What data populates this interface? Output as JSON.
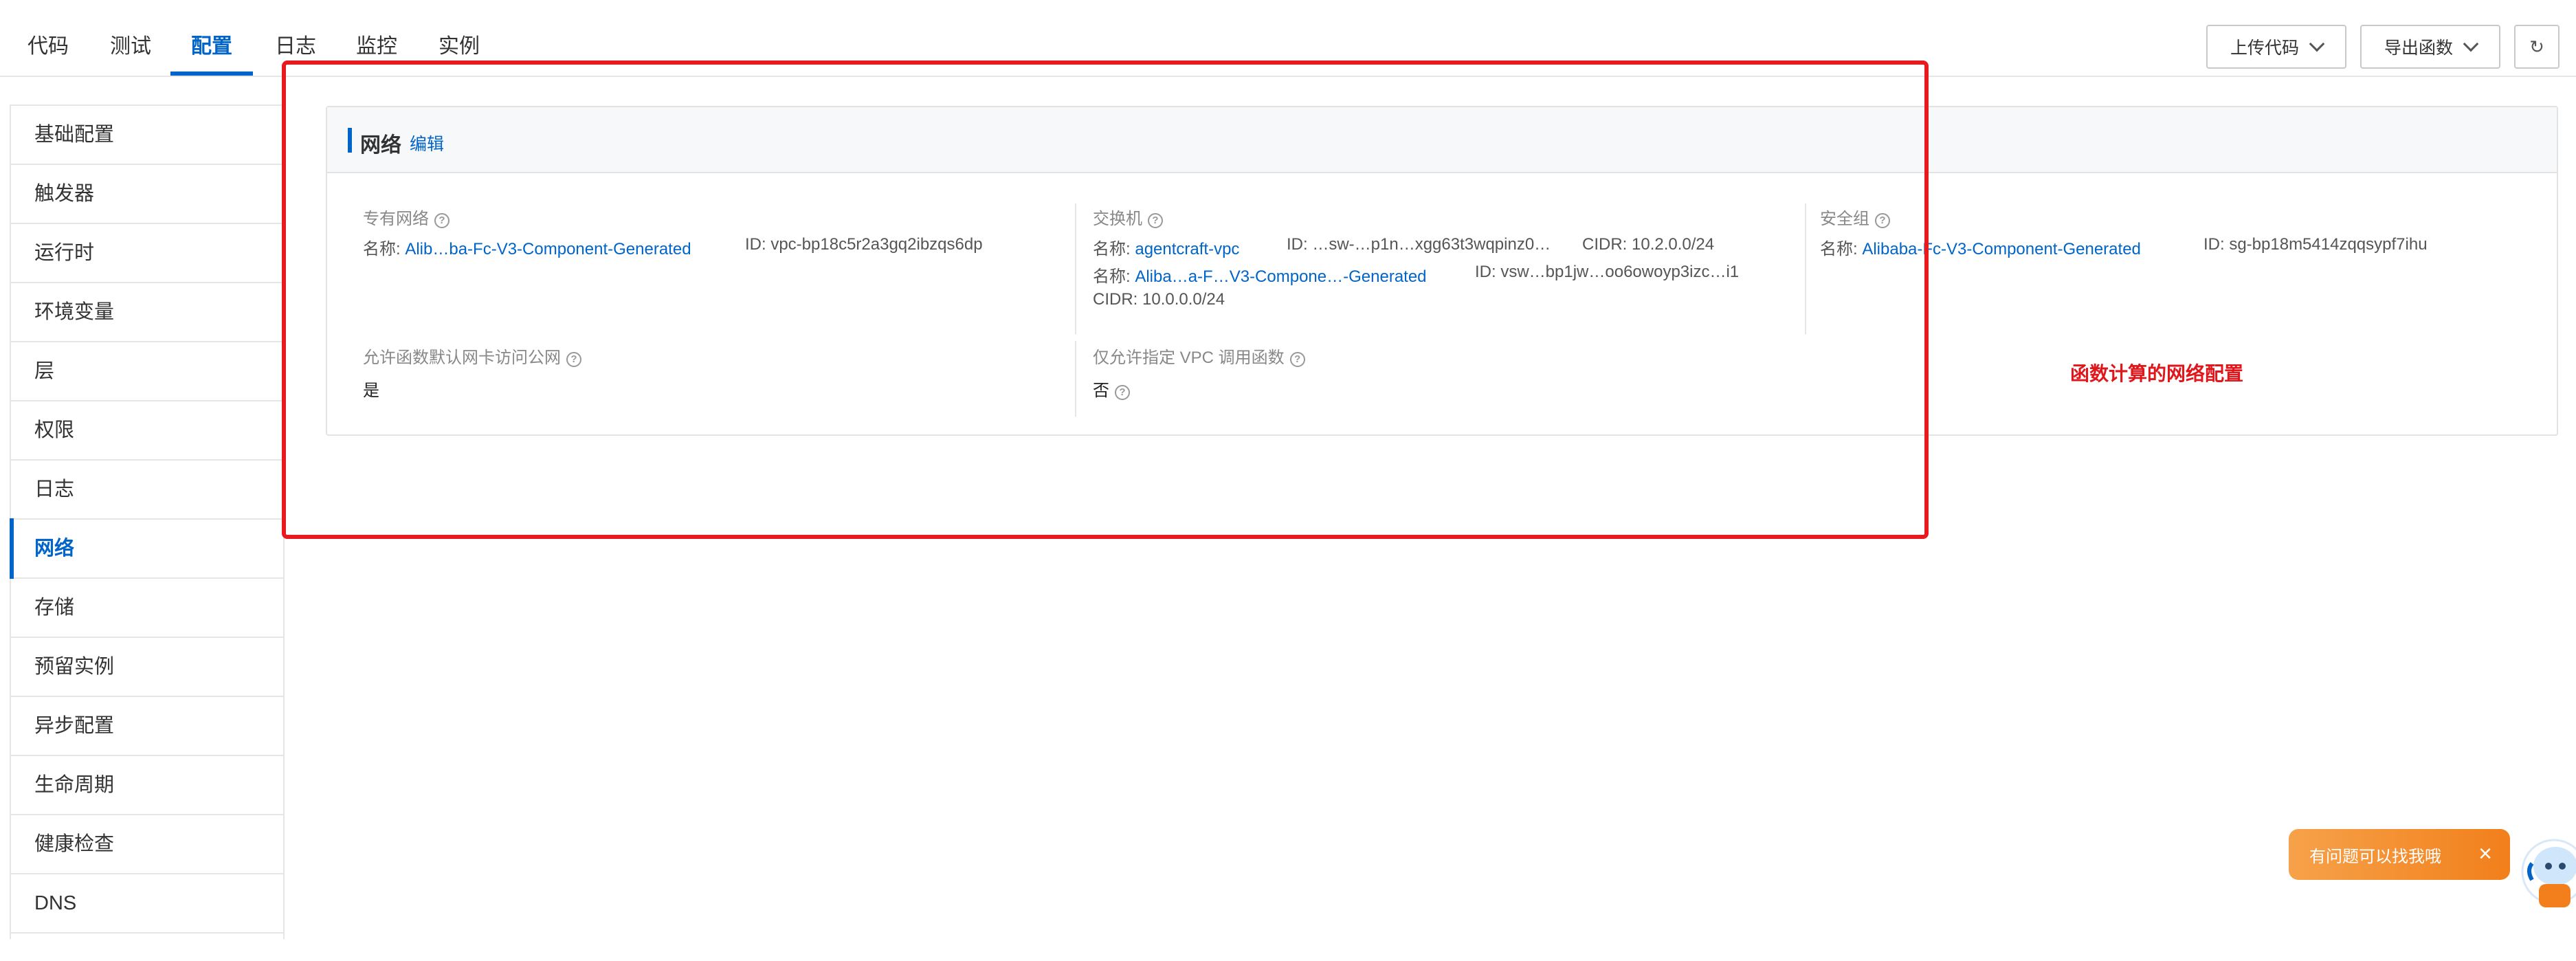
{
  "tabs": [
    {
      "label": "代码",
      "active": false
    },
    {
      "label": "测试",
      "active": false
    },
    {
      "label": "配置",
      "active": true
    },
    {
      "label": "日志",
      "active": false
    },
    {
      "label": "监控",
      "active": false
    },
    {
      "label": "实例",
      "active": false
    }
  ],
  "toolbar": {
    "upload_label": "上传代码",
    "export_label": "导出函数",
    "refresh_icon": "refresh-icon"
  },
  "sidebar": {
    "items": [
      {
        "label": "基础配置"
      },
      {
        "label": "触发器"
      },
      {
        "label": "运行时"
      },
      {
        "label": "环境变量"
      },
      {
        "label": "层"
      },
      {
        "label": "权限"
      },
      {
        "label": "日志"
      },
      {
        "label": "网络",
        "active": true
      },
      {
        "label": "存储"
      },
      {
        "label": "预留实例"
      },
      {
        "label": "异步配置"
      },
      {
        "label": "生命周期"
      },
      {
        "label": "健康检查"
      },
      {
        "label": "DNS"
      }
    ]
  },
  "network": {
    "title": "网络",
    "edit_label": "编辑",
    "vpc": {
      "label": "专有网络",
      "name_prefix": "名称:",
      "name": "Alib…ba-Fc-V3-Component-Generated",
      "id_text": "ID: vpc-bp18c5r2a3gq2ibzqs6dp"
    },
    "vswitch": {
      "label": "交换机",
      "row1_name_prefix": "名称:",
      "row1_name": "agentcraft-vpc",
      "row1_id": "ID: …sw-…p1n…xgg63t3wqpinz0…",
      "row1_cidr": "CIDR: 10.2.0.0/24",
      "row2_name_prefix": "名称:",
      "row2_name": "Aliba…a-F…V3-Compone…-Generated",
      "row2_id": "ID: vsw…bp1jw…oo6owoyp3izc…i1",
      "row3_cidr": "CIDR: 10.0.0.0/24"
    },
    "security_group": {
      "label": "安全组",
      "name_prefix": "名称:",
      "name": "Alibaba-Fc-V3-Component-Generated",
      "id_text": "ID: sg-bp18m5414zqqsypf7ihu"
    },
    "internet_access": {
      "label": "允许函数默认网卡访问公网",
      "value": "是"
    },
    "vpc_invoke_only": {
      "label": "仅允许指定 VPC 调用函数",
      "value": "否"
    }
  },
  "annotation": {
    "text": "函数计算的网络配置",
    "color": "#e0161a"
  },
  "help_widget": {
    "text": "有问题可以找我哦",
    "close": "×"
  },
  "colors": {
    "accent": "#0064c8",
    "highlight": "#e81a1e",
    "help": "#f27f1b"
  }
}
